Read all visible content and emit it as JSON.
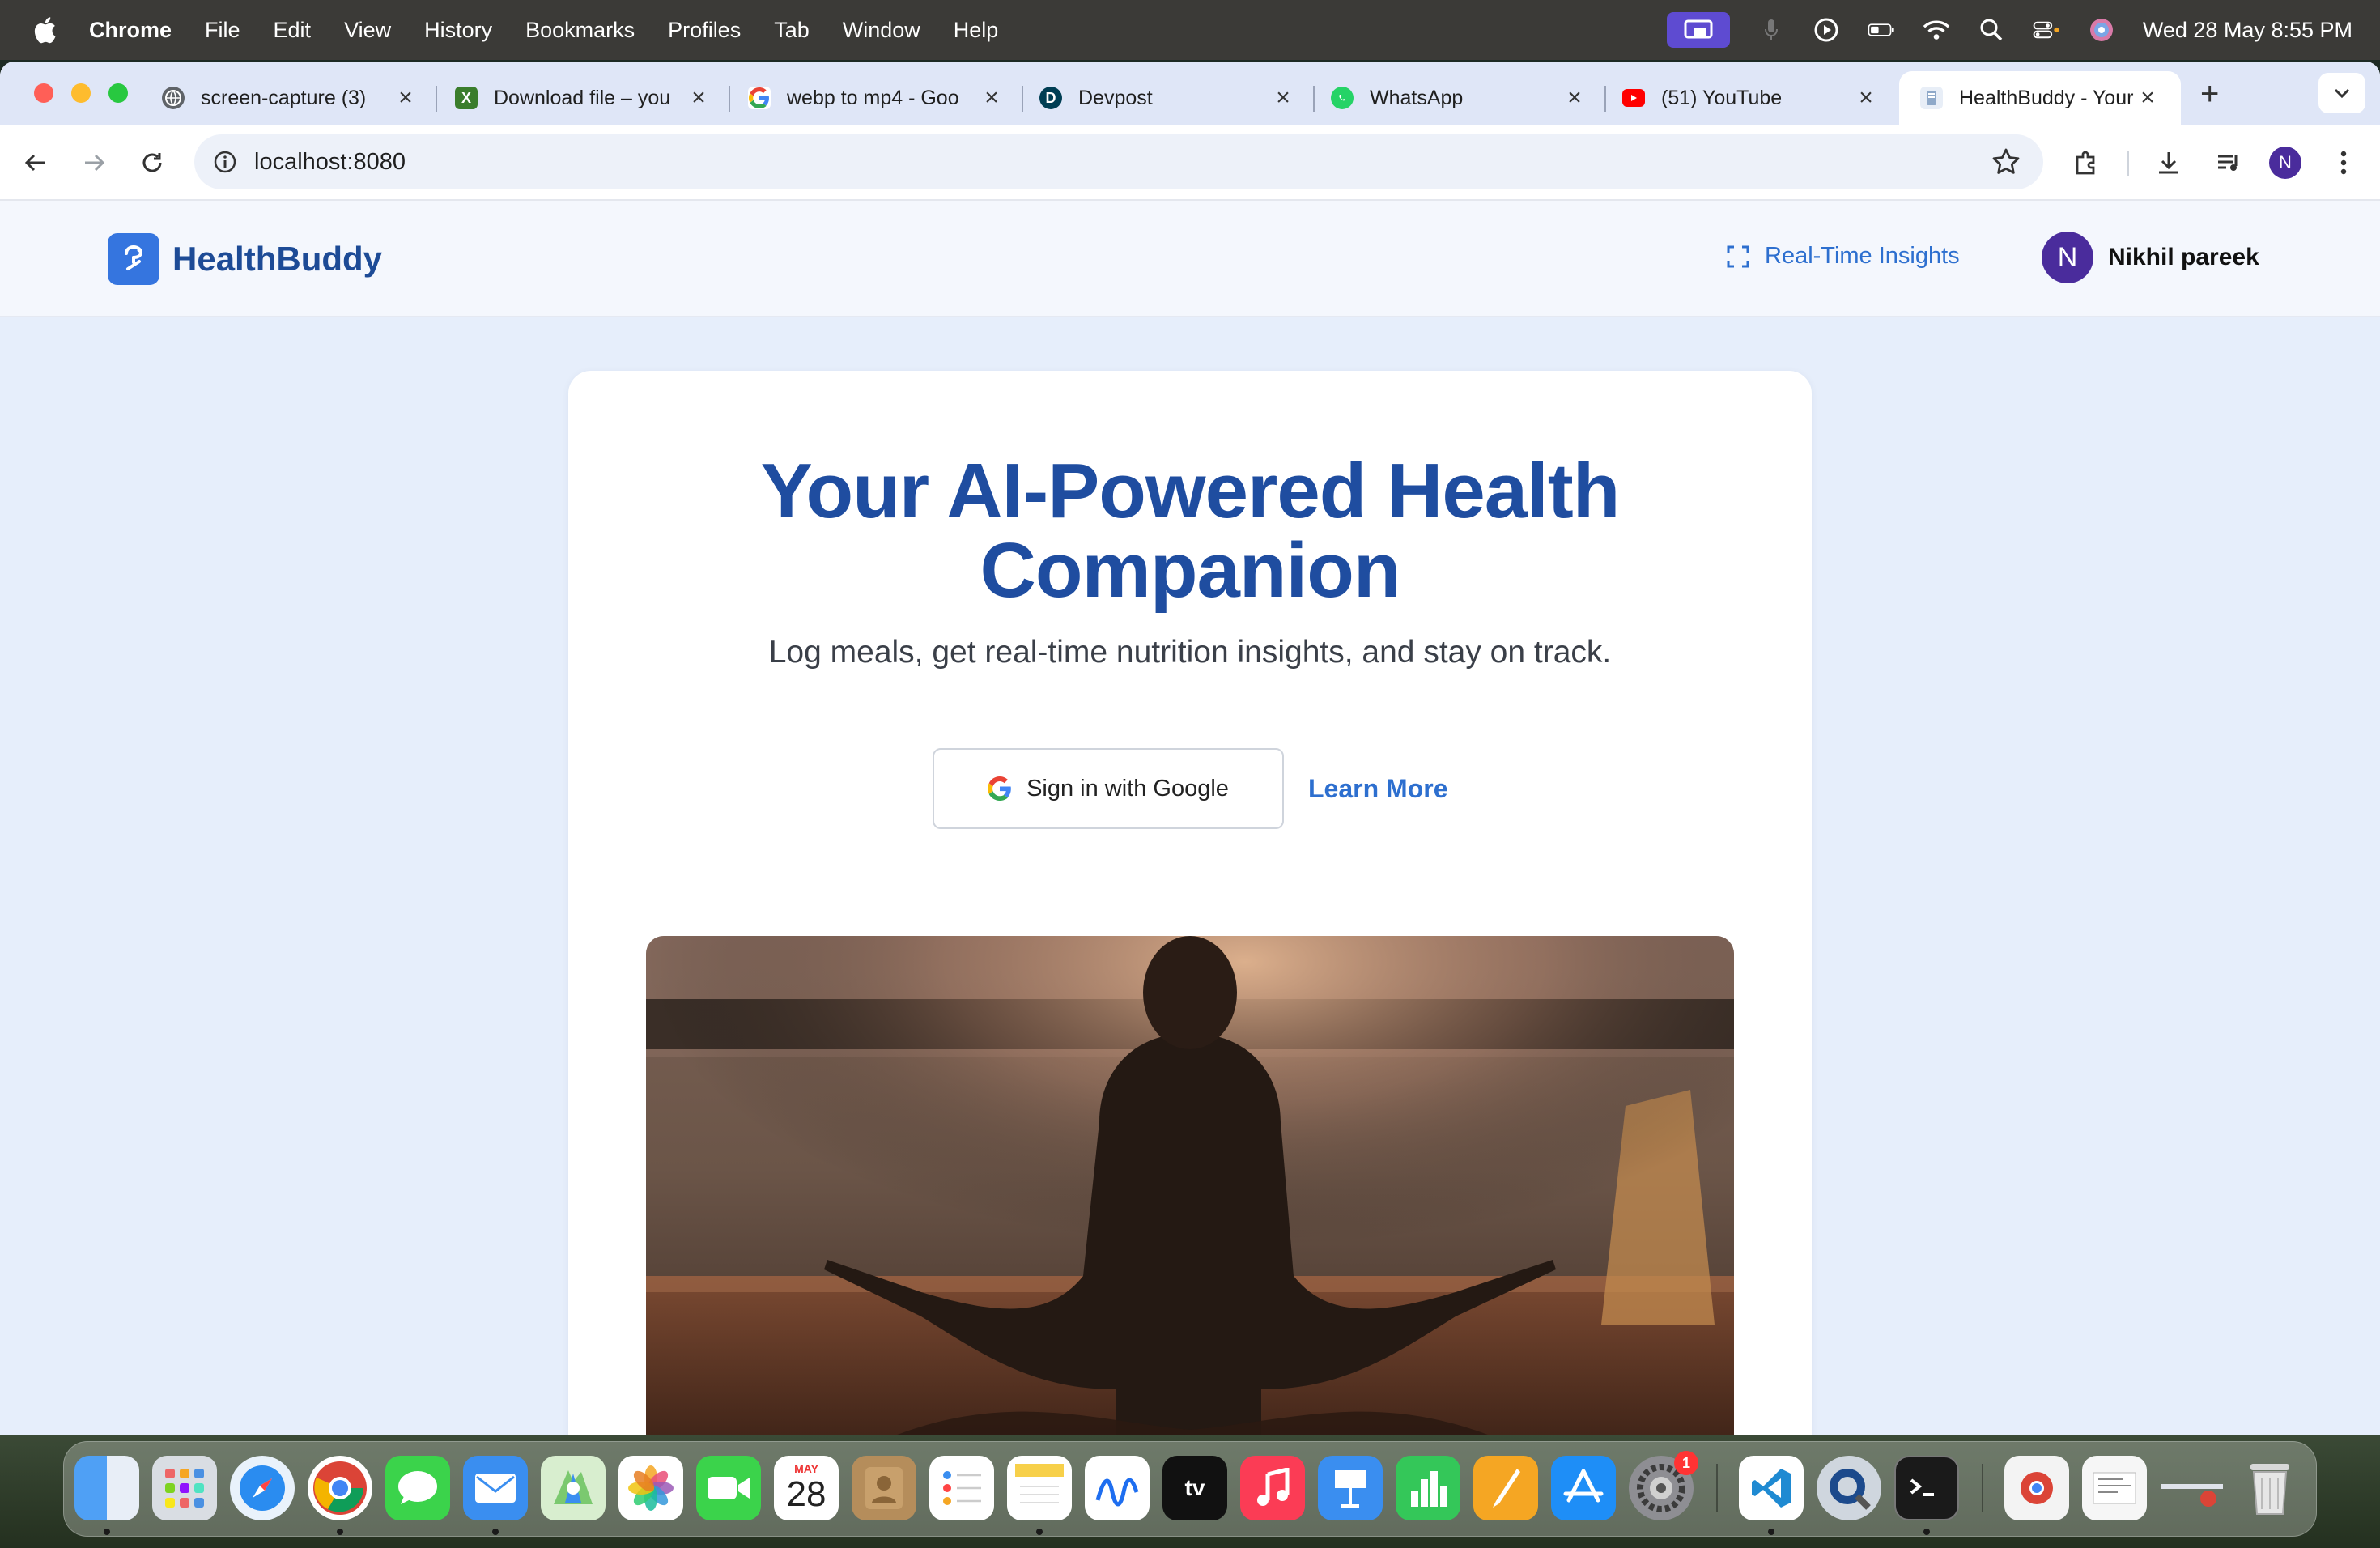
{
  "menubar": {
    "app": "Chrome",
    "items": [
      "File",
      "Edit",
      "View",
      "History",
      "Bookmarks",
      "Profiles",
      "Tab",
      "Window",
      "Help"
    ],
    "clock": "Wed 28 May  8:55 PM"
  },
  "tabs": [
    {
      "title": "screen-capture (3)",
      "icon": "globe-icon"
    },
    {
      "title": "Download file – you",
      "icon": "download-site-icon"
    },
    {
      "title": "webp to mp4 - Goo",
      "icon": "google-icon"
    },
    {
      "title": "Devpost",
      "icon": "devpost-icon"
    },
    {
      "title": "WhatsApp",
      "icon": "whatsapp-icon"
    },
    {
      "title": "(51) YouTube",
      "icon": "youtube-icon"
    },
    {
      "title": "HealthBuddy - Your",
      "icon": "healthbuddy-icon",
      "active": true
    }
  ],
  "toolbar": {
    "url": "localhost:8080",
    "profile_initial": "N"
  },
  "app": {
    "brand": "HealthBuddy",
    "nav_insights": "Real-Time Insights",
    "user_initial": "N",
    "user_name": "Nikhil pareek"
  },
  "hero": {
    "title_line1": "Your AI-Powered Health",
    "title_line2": "Companion",
    "subtitle": "Log meals, get real-time nutrition insights, and stay on track.",
    "google_button": "Sign in with Google",
    "learn_more": "Learn More",
    "image_alt": "meditation-photo"
  },
  "dock": {
    "calendar_month": "MAY",
    "calendar_day": "28",
    "settings_badge": "1",
    "tv_label": "tv"
  },
  "colors": {
    "brand_blue": "#1f4da0",
    "link_blue": "#2d6fcf",
    "page_bg": "#e6eefb",
    "avatar_purple": "#4a2c9c"
  }
}
